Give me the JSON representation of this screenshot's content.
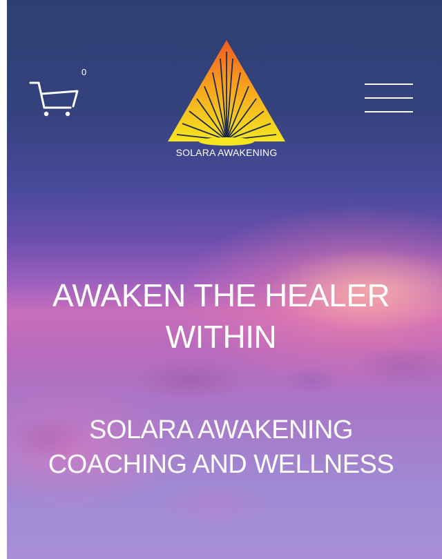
{
  "header": {
    "cart": {
      "icon": "shopping-cart-icon",
      "count": "0"
    },
    "logo": {
      "icon": "solara-triangle-logo",
      "text": "SOLARA AWAKENING"
    },
    "menu": {
      "icon": "hamburger-menu-icon"
    }
  },
  "hero": {
    "headline_lines": [
      "AWAKEN THE HEALER",
      "WITHIN"
    ],
    "subheadline_lines": [
      "SOLARA AWAKENING",
      "COACHING AND WELLNESS"
    ]
  },
  "colors": {
    "sky_top": "#2f3f73",
    "sky_mid": "#c76fba",
    "sky_bottom": "#a88fd6",
    "logo_top": "#f06a2a",
    "logo_bottom": "#f5e61e",
    "text": "#ffffff"
  }
}
